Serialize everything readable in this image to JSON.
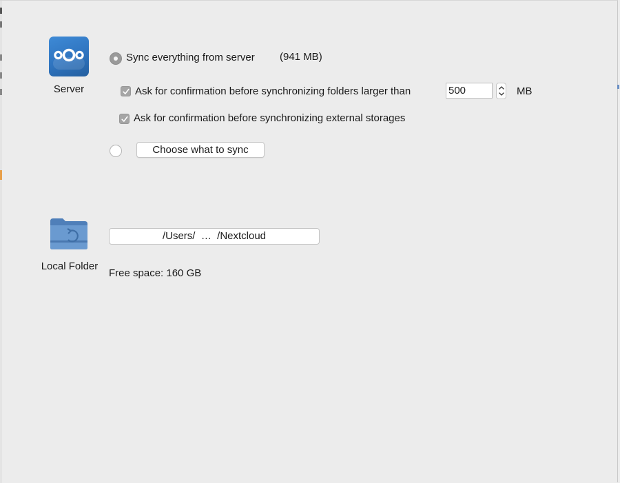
{
  "server": {
    "icon": "nextcloud-logo-icon",
    "label": "Server"
  },
  "sync": {
    "sync_everything_label": "Sync everything from server",
    "size": "(941 MB)",
    "sync_everything_selected": true,
    "confirm_large": {
      "checked": true,
      "label": "Ask for confirmation before synchronizing folders larger than",
      "value": "500",
      "unit": "MB"
    },
    "confirm_external": {
      "checked": true,
      "label": "Ask for confirmation before synchronizing external storages"
    },
    "choose_selected": false,
    "choose_button_label": "Choose what to sync"
  },
  "local_folder": {
    "icon": "sync-folder-icon",
    "label": "Local Folder",
    "path_parts": [
      "/Users/",
      "…",
      "/Nextcloud"
    ],
    "free_space": "Free space: 160 GB"
  }
}
